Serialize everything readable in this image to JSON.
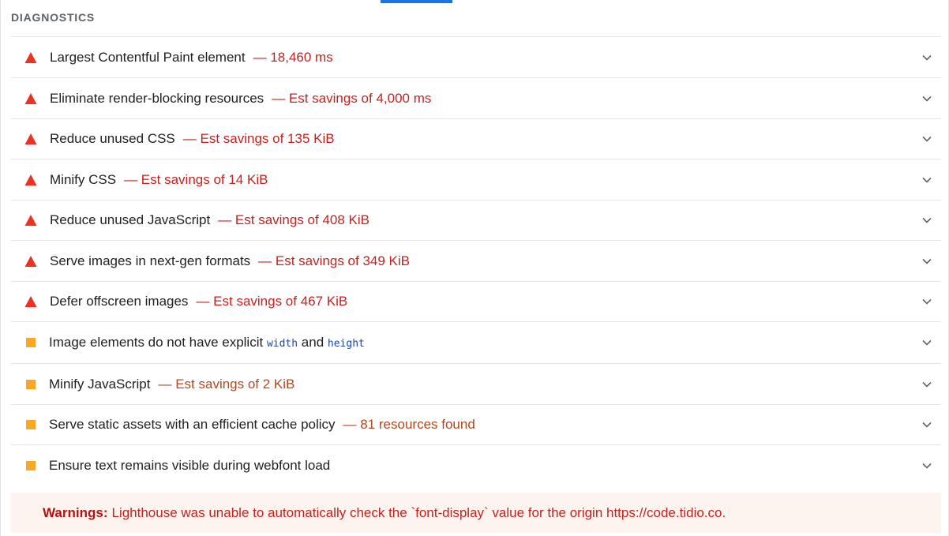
{
  "section": {
    "title": "DIAGNOSTICS"
  },
  "audits": [
    {
      "severity": "fail",
      "title": "Largest Contentful Paint element",
      "display_value": "— 18,460 ms"
    },
    {
      "severity": "fail",
      "title": "Eliminate render-blocking resources",
      "display_value": "— Est savings of 4,000 ms"
    },
    {
      "severity": "fail",
      "title": "Reduce unused CSS",
      "display_value": "— Est savings of 135 KiB"
    },
    {
      "severity": "fail",
      "title": "Minify CSS",
      "display_value": "— Est savings of 14 KiB"
    },
    {
      "severity": "fail",
      "title": "Reduce unused JavaScript",
      "display_value": "— Est savings of 408 KiB"
    },
    {
      "severity": "fail",
      "title": "Serve images in next-gen formats",
      "display_value": "— Est savings of 349 KiB"
    },
    {
      "severity": "fail",
      "title": "Defer offscreen images",
      "display_value": "— Est savings of 467 KiB"
    },
    {
      "severity": "average",
      "title_parts": [
        "Image elements do not have explicit ",
        "width",
        " and ",
        "height"
      ]
    },
    {
      "severity": "average",
      "title": "Minify JavaScript",
      "display_value": "— Est savings of 2 KiB"
    },
    {
      "severity": "average",
      "title": "Serve static assets with an efficient cache policy",
      "display_value": "— 81 resources found"
    },
    {
      "severity": "average",
      "title": "Ensure text remains visible during webfont load",
      "display_value": ""
    }
  ],
  "warning": {
    "label": "Warnings:",
    "text": "Lighthouse was unable to automatically check the `font-display` value for the origin https://code.tidio.co."
  },
  "colors": {
    "fail": "#eb3223",
    "average": "#f9a825",
    "fail_text": "#c5221f",
    "average_text": "#b5471a",
    "tab_indicator": "#1a73e8",
    "warning_bg": "#fdf4ef"
  },
  "icons": {
    "fail": "triangle-icon",
    "average": "square-icon",
    "expand": "chevron-down-icon"
  }
}
